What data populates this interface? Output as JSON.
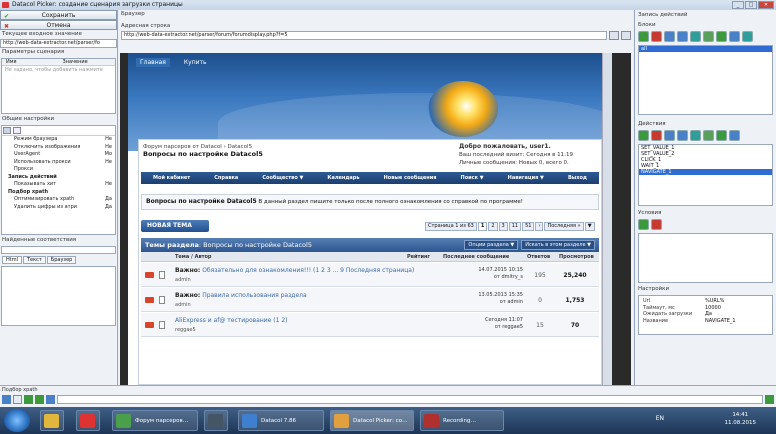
{
  "window": {
    "title": "Datacol Picker: создание сценария загрузки страницы",
    "buttons": [
      "_",
      "□",
      "✕"
    ]
  },
  "left": {
    "save_label": "Сохранить",
    "cancel_label": "Отмена",
    "current_url_label": "Текущее входное значение",
    "current_url_value": "http://web-data-extractor.net/parser/fo",
    "params_label": "Параметры сценария",
    "params_cols": [
      "Имя",
      "Значение"
    ],
    "params_hint": "Не задано, чтобы добавить нажмите",
    "general_label": "Общие настройки",
    "settings": [
      {
        "name": "Режим браузера",
        "value": "Нe",
        "bold": false
      },
      {
        "name": "Отключить изображения",
        "value": "Нe",
        "bold": false
      },
      {
        "name": "UserAgent",
        "value": "Mo",
        "bold": false
      },
      {
        "name": "Использовать прокси",
        "value": "Нe",
        "bold": false
      },
      {
        "name": "Прокси",
        "value": "",
        "bold": false
      },
      {
        "name": "Запись действий",
        "value": "",
        "bold": true
      },
      {
        "name": "Показывать хит",
        "value": "Нe",
        "bold": false
      },
      {
        "name": "Подбор xpath",
        "value": "",
        "bold": true
      },
      {
        "name": "Оптимизировать xpath",
        "value": "Да",
        "bold": false
      },
      {
        "name": "Удалить цифры из атри",
        "value": "Да",
        "bold": false
      }
    ],
    "matches_label": "Найденные соответствия",
    "tabs": [
      "Html",
      "Текст",
      "Браузер"
    ]
  },
  "center": {
    "browser_label": "Браузер",
    "address_label": "Адресная строка",
    "address_value": "http://web-data-extractor.net/parser/forum/forumdisplay.php?f=5",
    "site": {
      "nav": [
        "Главная",
        "Купить"
      ],
      "breadcrumb_top": "Форум парсеров от Datacol › Datacol5",
      "page_heading": "Вопросы по настройке Datacol5",
      "welcome_title": "Добро пожаловать, user1.",
      "welcome_last": "Ваш последний визит: Сегодня в 11:19",
      "welcome_msgs": "Личные сообщения: Новых 0, всего 0.",
      "menu": [
        "Мой кабинет",
        "Справка",
        "Сообщество ▼",
        "Календарь",
        "Новые сообщения",
        "Поиск ▼",
        "Навигация ▼",
        "Выход"
      ],
      "intro_title": "Вопросы по настройке Datacol5",
      "intro_text": "В данный раздел пишите только после полного ознакомления со справкой по программе!",
      "new_topic": "НОВАЯ ТЕМА",
      "pager": [
        "Страница 1 из 63",
        "1",
        "2",
        "3",
        "11",
        "51",
        "›",
        "Последняя »",
        "▼"
      ],
      "section_title": "Темы раздела",
      "section_sub": ": Вопросы по настройке Datacol5",
      "section_buttons": [
        "Опции раздела ▼",
        "Искать в этом разделе ▼"
      ],
      "columns": [
        "Тема / Автор",
        "Рейтинг",
        "Последнее сообщение",
        "Ответов",
        "Просмотров"
      ],
      "threads": [
        {
          "prefix": "Важно:",
          "title": "Обязательно для ознакомления!!!",
          "pages": "(1 2 3 ... 9 Последняя страница)",
          "author": "admin",
          "last_date": "14.07.2015 10:15",
          "last_by": "от dmitry_s",
          "replies": "195",
          "views": "25,240"
        },
        {
          "prefix": "Важно:",
          "title": "Правила использования раздела",
          "pages": "",
          "author": "admin",
          "last_date": "13.05.2013 15:35",
          "last_by": "от admin",
          "replies": "0",
          "views": "1,753"
        },
        {
          "prefix": "",
          "title": "AliExpress и af@ тестирование",
          "pages": "(1 2)",
          "author": "reggae5",
          "last_date": "Сегодня 11:07",
          "last_by": "от reggae5",
          "replies": "15",
          "views": "70"
        }
      ]
    }
  },
  "right": {
    "record_label": "Запись действий",
    "blocks_label": "Блоки",
    "blocks": [
      "all"
    ],
    "actions_label": "Действия",
    "actions": [
      "SET_VALUE_1",
      "SET_VALUE_2",
      "CLICK_1",
      "WAIT_1",
      "NAVIGATE_1"
    ],
    "selected_action": "NAVIGATE_1",
    "conditions_label": "Условия",
    "settings_label": "Настройки",
    "props": [
      {
        "k": "Url",
        "v": "%URL%"
      },
      {
        "k": "Таймаут, мс",
        "v": "10000"
      },
      {
        "k": "Ожидать загрузки",
        "v": "Да"
      },
      {
        "k": "Название",
        "v": "NAVIGATE_1"
      }
    ]
  },
  "bottom": {
    "xpath_label": "Подбор xpath"
  },
  "taskbar": {
    "items": [
      "Форум парсеров…",
      "",
      "Datacol 7.86",
      "Datacol Picker: co…",
      "Recording…"
    ],
    "lang": "EN",
    "time": "14:41",
    "date": "11.08.2015"
  }
}
